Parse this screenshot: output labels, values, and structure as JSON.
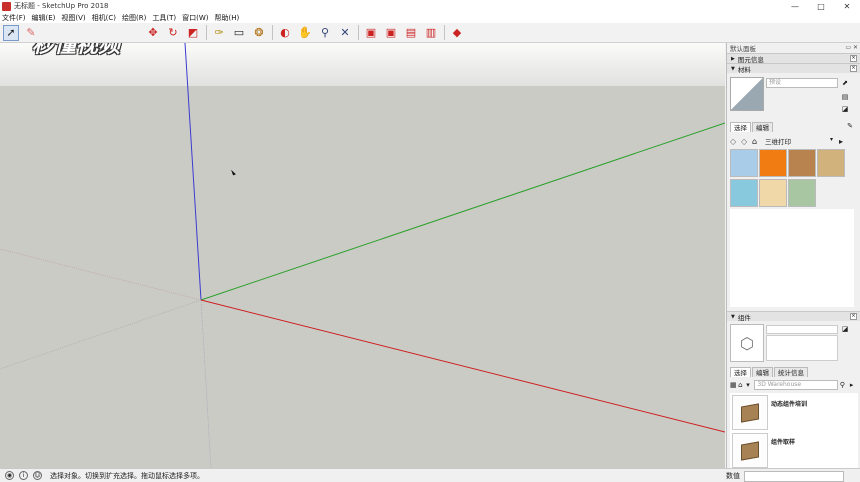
{
  "window": {
    "title": "无标题 - SketchUp Pro 2018",
    "min": "—",
    "max": "□",
    "close": "✕"
  },
  "menu": [
    "文件(F)",
    "编辑(E)",
    "视图(V)",
    "相机(C)",
    "绘图(R)",
    "工具(T)",
    "窗口(W)",
    "帮助(H)"
  ],
  "toolbar_icons": [
    "select-tool",
    "eraser-tool",
    "watermark-covered",
    "move-tool",
    "rotate-tool",
    "scale-tool",
    "tape-measure-tool",
    "text-tool",
    "paint-bucket-tool",
    "orbit-tool",
    "pan-tool",
    "zoom-tool",
    "zoom-extents-tool",
    "3d-warehouse-tool",
    "extension-warehouse-tool",
    "layout-tool",
    "ruby-tool"
  ],
  "watermark": "秒懂视频",
  "tray": {
    "title": "默认面板",
    "entity_info": "图元信息",
    "materials": "材料",
    "material_name_placeholder": "预设",
    "tabs": [
      "选择",
      "编辑"
    ],
    "library": "三维打印",
    "swatch_colors": [
      "#a9cde9",
      "#f07c12",
      "#b8834e",
      "#d1b27d",
      "#89c9de",
      "#f1d8a8",
      "#a8c6a2"
    ],
    "components": "组件",
    "comp_tabs": [
      "选择",
      "编辑",
      "统计信息"
    ],
    "search_placeholder": "3D Warehouse",
    "comp_items": [
      "动态组件培训",
      "组件取样"
    ]
  },
  "status": {
    "message": "选择对象。切换到扩充选择。拖动鼠标选择多项。",
    "vcb_label": "数值"
  },
  "colors": {
    "axis_blue": "#3b3bd0",
    "axis_green": "#2aa02a",
    "axis_red": "#cc2020",
    "viewport_ground": "#cbcbc6"
  }
}
